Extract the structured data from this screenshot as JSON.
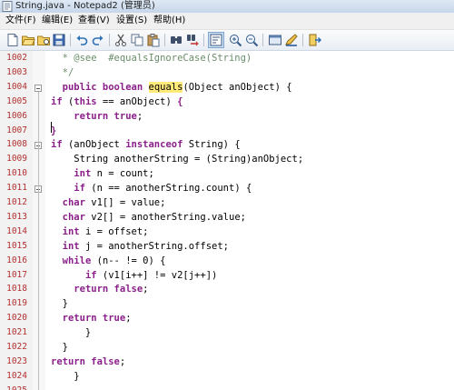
{
  "window": {
    "title": "String.java - Notepad2 (管理员)"
  },
  "menu": [
    "文件(F)",
    "编辑(E)",
    "查看(V)",
    "设置(S)",
    "帮助(H)"
  ],
  "toolbar_icons": [
    "new-file-icon",
    "open-folder-icon",
    "browse-icon",
    "save-icon",
    "undo-icon",
    "redo-icon",
    "cut-icon",
    "copy-icon",
    "paste-icon",
    "find-icon",
    "replace-icon",
    "word-wrap-icon",
    "zoom-in-icon",
    "zoom-out-icon",
    "view-icon",
    "edit-icon",
    "exit-icon"
  ],
  "colors": {
    "keyword": "#8a1f8a",
    "comment": "#6a8d6a",
    "line_number": "#b23030",
    "highlight": "#ffea7a"
  },
  "editor": {
    "line_numbers": [
      "1002",
      "1003",
      "1004",
      "1005",
      "1006",
      "1007",
      "1008",
      "1009",
      "1010",
      "1011",
      "1012",
      "1013",
      "1014",
      "1015",
      "1016",
      "1017",
      "1018",
      "1019",
      "1020",
      "1021",
      "1022",
      "1023",
      "1024",
      "1025"
    ],
    "lines": [
      [
        {
          "t": "  * @see  #equalsIgnoreCase(String)",
          "c": "cm"
        }
      ],
      [
        {
          "t": "  */",
          "c": "cm"
        }
      ],
      [
        {
          "t": "  ",
          "c": ""
        },
        {
          "t": "public boolean",
          "c": "kw"
        },
        {
          "t": " ",
          "c": ""
        },
        {
          "t": "equals",
          "c": "fn"
        },
        {
          "t": "(Object anObject) {",
          "c": ""
        }
      ],
      [
        {
          "t": "if",
          "c": "kw"
        },
        {
          "t": " (",
          "c": ""
        },
        {
          "t": "this",
          "c": "kw"
        },
        {
          "t": " == anObject) ",
          "c": ""
        },
        {
          "t": "{",
          "c": "kw"
        }
      ],
      [
        {
          "t": "    ",
          "c": ""
        },
        {
          "t": "return true",
          "c": "kw"
        },
        {
          "t": ";",
          "c": ""
        }
      ],
      [
        {
          "t": "}",
          "c": "kw"
        }
      ],
      [
        {
          "t": "if",
          "c": "kw"
        },
        {
          "t": " (anObject ",
          "c": ""
        },
        {
          "t": "instanceof",
          "c": "kw"
        },
        {
          "t": " String) {",
          "c": ""
        }
      ],
      [
        {
          "t": "    String anotherString = (String)anObject;",
          "c": ""
        }
      ],
      [
        {
          "t": "    ",
          "c": ""
        },
        {
          "t": "int",
          "c": "kw"
        },
        {
          "t": " n = count;",
          "c": ""
        }
      ],
      [
        {
          "t": "    ",
          "c": ""
        },
        {
          "t": "if",
          "c": "kw"
        },
        {
          "t": " (n == anotherString.count) {",
          "c": ""
        }
      ],
      [
        {
          "t": "  ",
          "c": ""
        },
        {
          "t": "char",
          "c": "kw"
        },
        {
          "t": " v1[] = value;",
          "c": ""
        }
      ],
      [
        {
          "t": "  ",
          "c": ""
        },
        {
          "t": "char",
          "c": "kw"
        },
        {
          "t": " v2[] = anotherString.value;",
          "c": ""
        }
      ],
      [
        {
          "t": "  ",
          "c": ""
        },
        {
          "t": "int",
          "c": "kw"
        },
        {
          "t": " i = offset;",
          "c": ""
        }
      ],
      [
        {
          "t": "  ",
          "c": ""
        },
        {
          "t": "int",
          "c": "kw"
        },
        {
          "t": " j = anotherString.offset;",
          "c": ""
        }
      ],
      [
        {
          "t": "  ",
          "c": ""
        },
        {
          "t": "while",
          "c": "kw"
        },
        {
          "t": " (n-- != 0) {",
          "c": ""
        }
      ],
      [
        {
          "t": "      ",
          "c": ""
        },
        {
          "t": "if",
          "c": "kw"
        },
        {
          "t": " (v1[i++] != v2[j++])",
          "c": ""
        }
      ],
      [
        {
          "t": "    ",
          "c": ""
        },
        {
          "t": "return false",
          "c": "kw"
        },
        {
          "t": ";",
          "c": ""
        }
      ],
      [
        {
          "t": "  }",
          "c": ""
        }
      ],
      [
        {
          "t": "  ",
          "c": ""
        },
        {
          "t": "return true",
          "c": "kw"
        },
        {
          "t": ";",
          "c": ""
        }
      ],
      [
        {
          "t": "      }",
          "c": ""
        }
      ],
      [
        {
          "t": "  }",
          "c": ""
        }
      ],
      [
        {
          "t": "return false",
          "c": "kw"
        },
        {
          "t": ";",
          "c": ""
        }
      ],
      [
        {
          "t": "    }",
          "c": ""
        }
      ],
      []
    ]
  }
}
